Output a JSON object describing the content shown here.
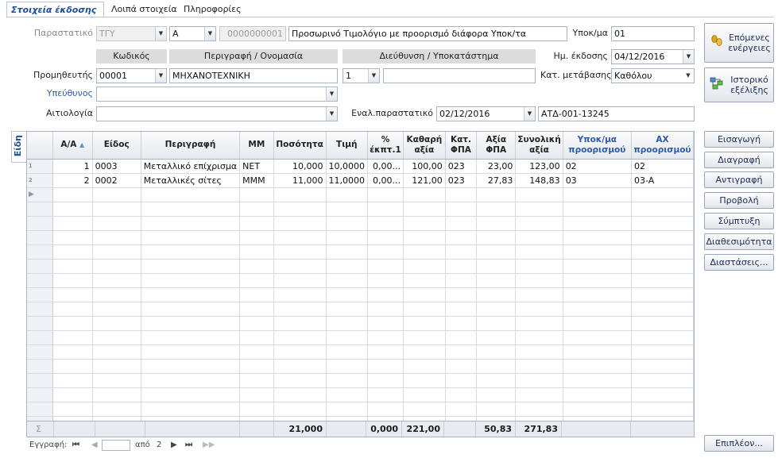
{
  "tabs": [
    "Στοιχεία έκδοσης",
    "Λοιπά στοιχεία",
    "Πληροφορίες"
  ],
  "form": {
    "parastatiko_label": "Παραστατικό",
    "series": "ΤΓΥ",
    "letter": "Α",
    "number": "0000000001",
    "description": "Προσωρινό Τιμολόγιο με προορισμό διάφορα Υποκ/τα",
    "ypok_label": "Υποκ/μα",
    "ypok_value": "01",
    "col_kodikos": "Κωδικός",
    "col_perigrafi": "Περιγραφή / Ονομασία",
    "col_dieythinsi": "Διεύθυνση / Υποκατάστημα",
    "issue_date_label": "Ημ. έκδοσης",
    "issue_date": "04/12/2016",
    "supplier_label": "Προμηθευτής",
    "supplier_code": "00001",
    "supplier_name": "ΜΗΧΑΝΟΤΕΧΝΙΚΗ",
    "branch": "1",
    "branch_desc": "",
    "transition_label": "Κατ. μετάβασης",
    "transition": "Καθόλου",
    "responsible_label": "Υπεύθυνος",
    "reason_label": "Αιτιολογία",
    "alt_doc_label": "Εναλ.παραστατικό",
    "alt_doc_date": "02/12/2016",
    "alt_doc_number": "ΑΤΔ-001-13245"
  },
  "side_buttons": {
    "next_actions": "Επόμενες ενέργειες",
    "history": "Ιστορικό εξέλιξης",
    "items": [
      "Εισαγωγή",
      "Διαγραφή",
      "Αντιγραφή",
      "Προβολή",
      "Σύμπτυξη",
      "Διαθεσιμότητα",
      "Διαστάσεις..."
    ],
    "more": "Επιπλέον..."
  },
  "vertical_tab": "Είδη",
  "grid": {
    "headers": [
      "Α/Α",
      "Είδος",
      "Περιγραφή",
      "ΜΜ",
      "Ποσότητα",
      "Τιμή",
      "% έκπτ.1",
      "Καθαρή αξία",
      "Κατ. ΦΠΑ",
      "Αξία ΦΠΑ",
      "Συνολική αξία",
      "Υποκ/μα προορισμού",
      "ΑΧ προορισμού"
    ],
    "rows": [
      {
        "ind": "1",
        "aa": "1",
        "eidos": "0003",
        "perigrafi": "Μεταλλικό επίχρισμα",
        "mm": "ΝΕΤ",
        "posotita": "10,000",
        "timi": "10,0000",
        "ekpt": "0,00...",
        "kathari": "100,00",
        "katfpa": "023",
        "axiafpa": "23,00",
        "synoliki": "123,00",
        "ypok": "02",
        "ax": "02"
      },
      {
        "ind": "2",
        "aa": "2",
        "eidos": "0002",
        "perigrafi": "Μεταλλικές σίτες",
        "mm": "ΜΜΜ",
        "posotita": "11,000",
        "timi": "11,0000",
        "ekpt": "0,00...",
        "kathari": "121,00",
        "katfpa": "023",
        "axiafpa": "27,83",
        "synoliki": "148,83",
        "ypok": "03",
        "ax": "03-A"
      }
    ],
    "totals": {
      "sigma": "Σ",
      "posotita": "21,000",
      "ekpt": "0,000",
      "kathari": "221,00",
      "axiafpa": "50,83",
      "synoliki": "271,83"
    }
  },
  "navigator": {
    "record_label": "Εγγραφή:",
    "of_label": "από",
    "total": "2",
    "current": ""
  }
}
